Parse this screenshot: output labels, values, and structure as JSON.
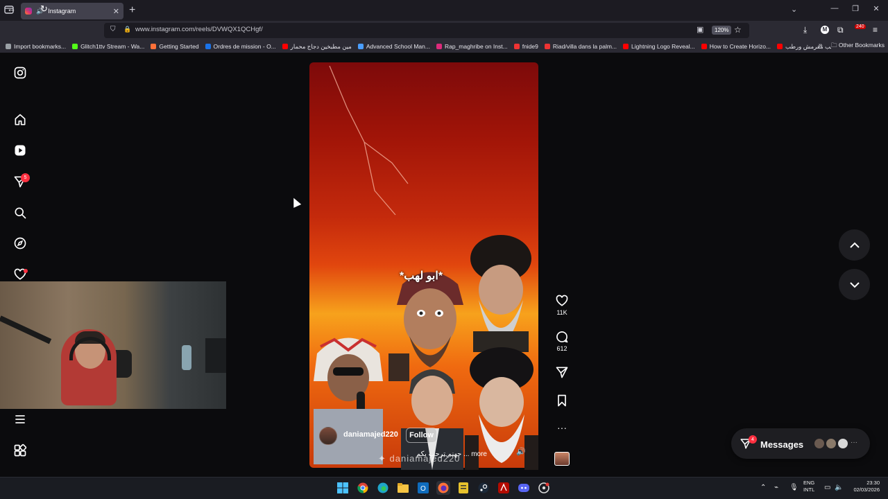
{
  "browser": {
    "tab_title": "Instagram",
    "url": "www.instagram.com/reels/DVWQX1QCHgf/",
    "zoom": "120%",
    "extension_badge": "240"
  },
  "bookmarks": [
    {
      "label": "Import bookmarks...",
      "color": "#9aa0a6"
    },
    {
      "label": "Glitch1ttv Stream - Wa...",
      "color": "#53fc18"
    },
    {
      "label": "Getting Started",
      "color": "#ff7139"
    },
    {
      "label": "Ordres de mission - O...",
      "color": "#1a73e8"
    },
    {
      "label": "مين مطبخين دجاج محمار",
      "color": "#ff0000"
    },
    {
      "label": "Advanced School Man...",
      "color": "#4a9eff"
    },
    {
      "label": "Rap_maghribe on Inst...",
      "color": "#dd2a7b"
    },
    {
      "label": "fnide9",
      "color": "#e33"
    },
    {
      "label": "Riad/villa dans la palm...",
      "color": "#e33"
    },
    {
      "label": "Lightning Logo Reveal...",
      "color": "#ff0000"
    },
    {
      "label": "How to Create Horizo...",
      "color": "#ff0000"
    },
    {
      "label": "صابون حليب مقرمش ورطب",
      "color": "#ff0000"
    }
  ],
  "bookmarks_more": "Other Bookmarks",
  "sidebar": {
    "notifications_count": "5"
  },
  "reel": {
    "caption_overlay": "*ابو لهب*",
    "author": "daniamajed220",
    "follow_label": "Follow",
    "description": "جهنم ترحب بكم ... more",
    "watermark": "✦ daniamajed220",
    "likes": "11K",
    "comments": "612"
  },
  "messages": {
    "label": "Messages",
    "badge": "4"
  },
  "taskbar": {
    "lang_line1": "ENG",
    "lang_line2": "INTL",
    "time": "23:30",
    "date": "02/03/2026"
  }
}
